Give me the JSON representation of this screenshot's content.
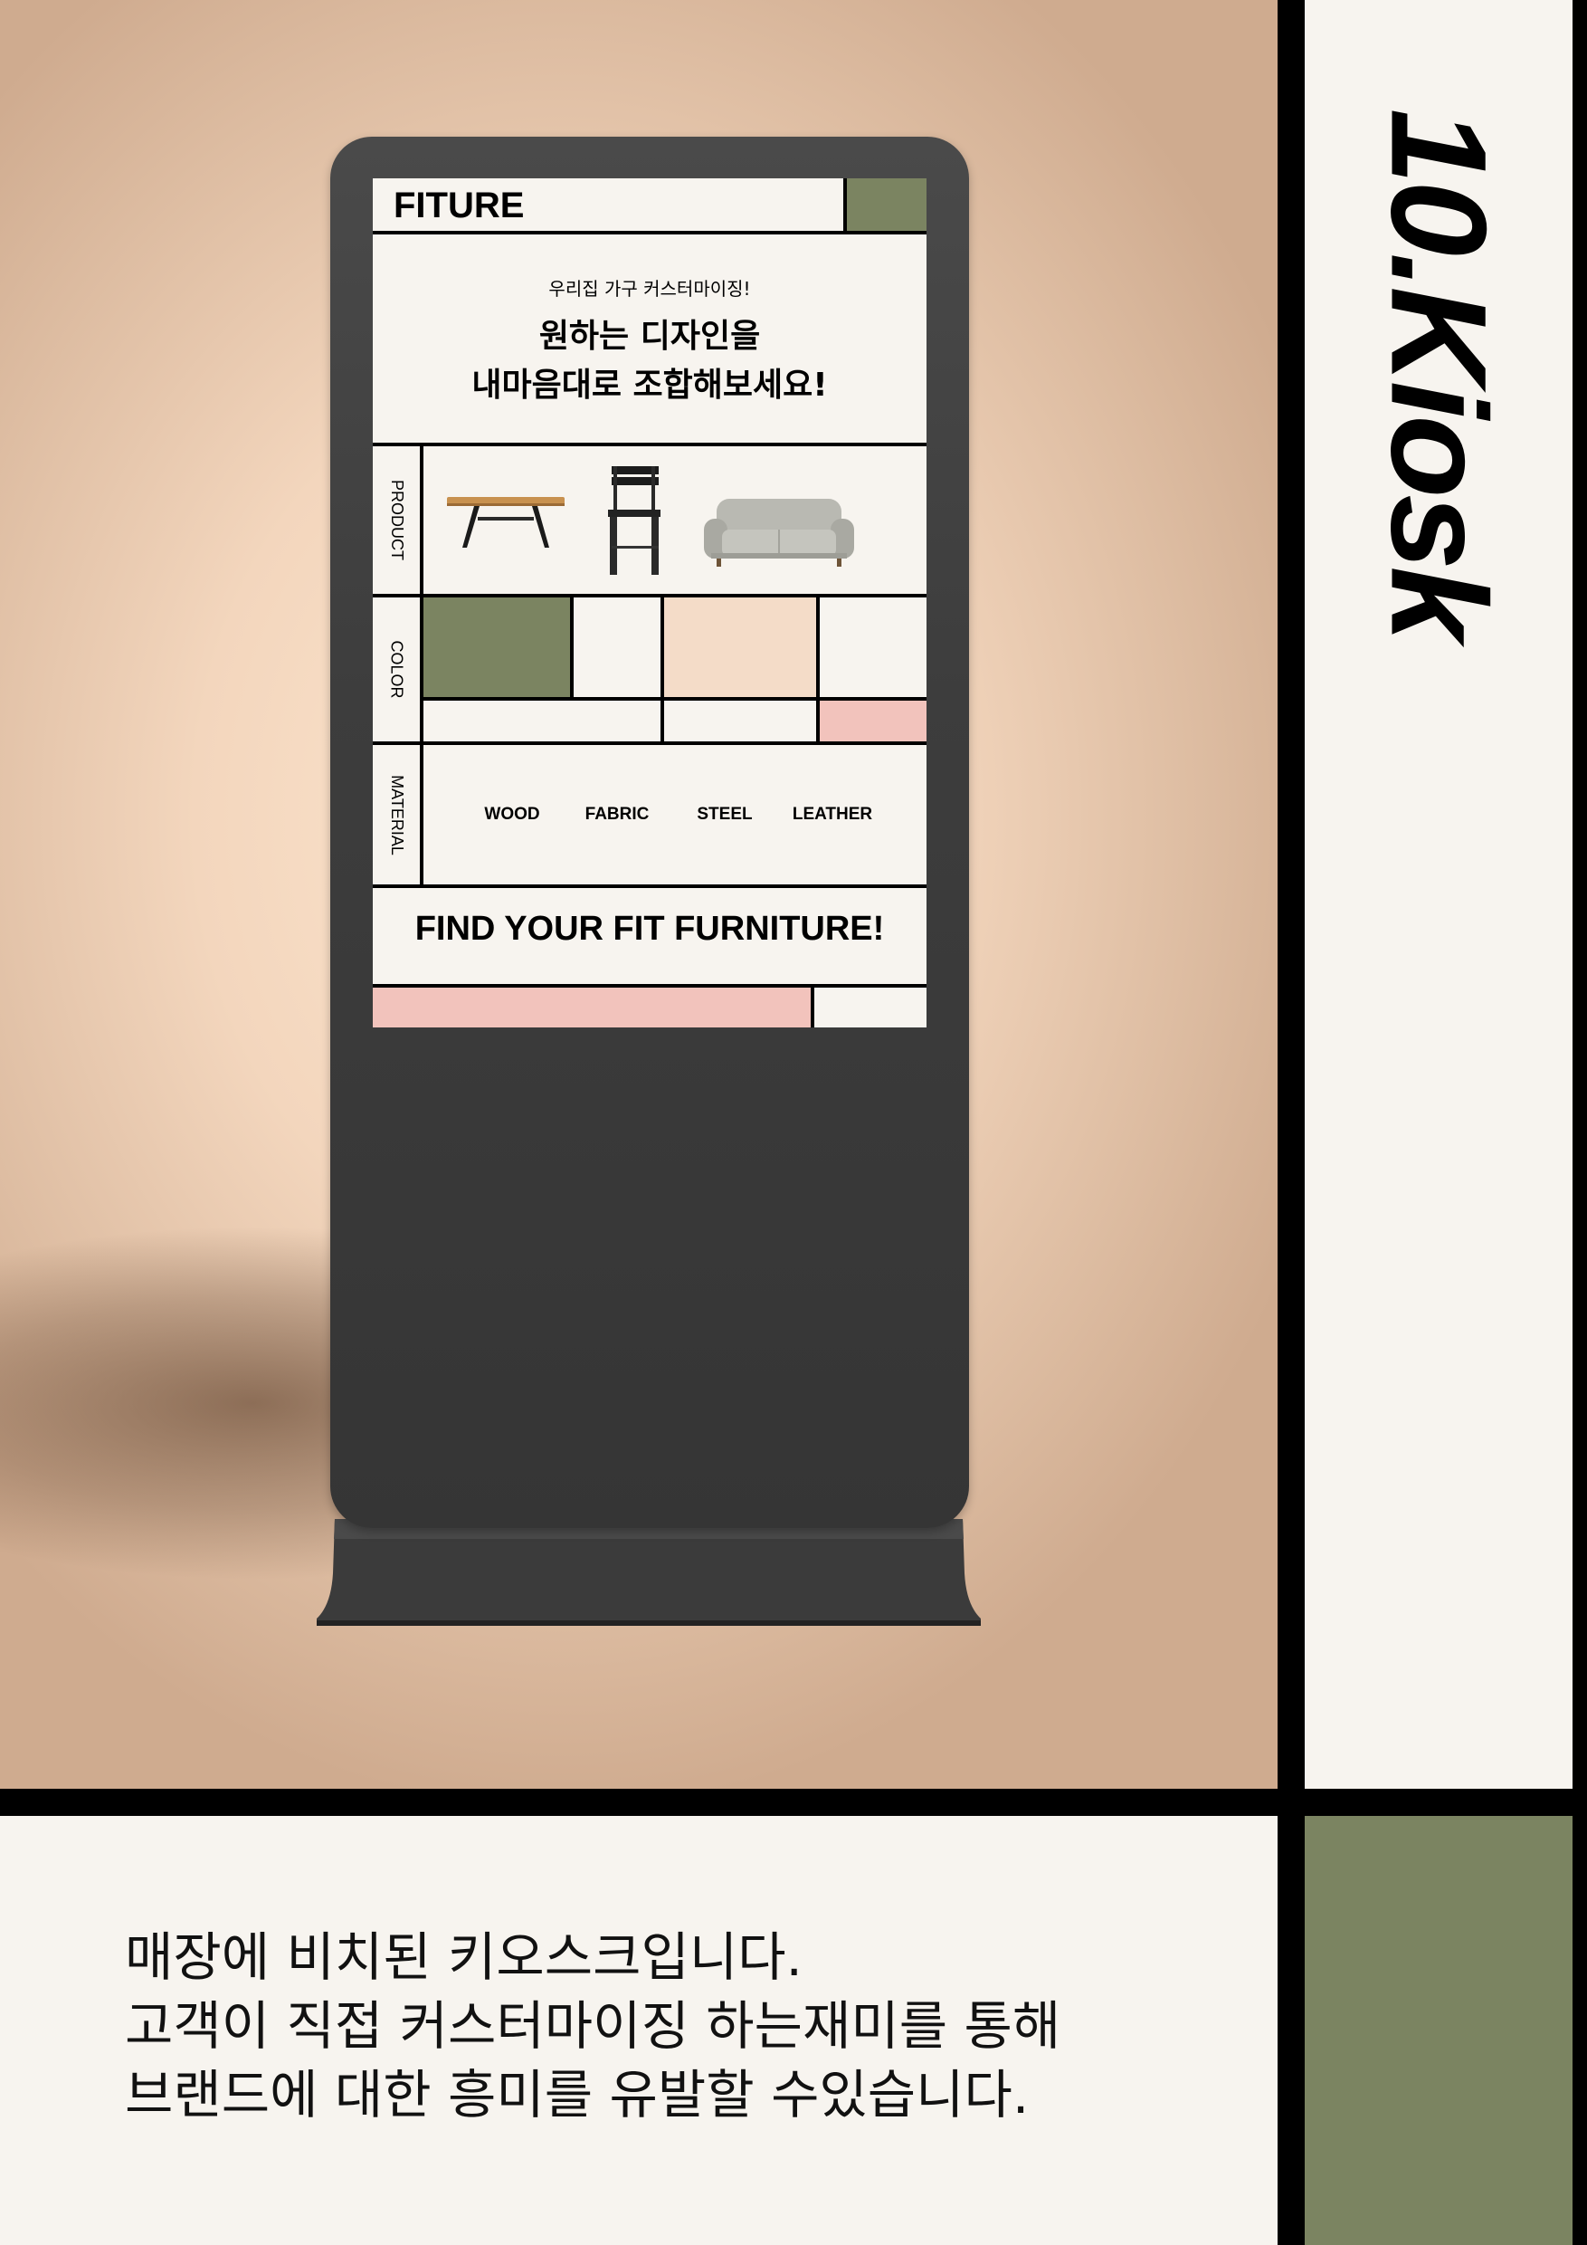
{
  "colors": {
    "olive": "#7b8461",
    "peach": "#f4dcc8",
    "pink": "#f2c3bc",
    "cream": "#f7f4ef",
    "kiosk_body": "#3d3d3d"
  },
  "brand": {
    "title": "10.Kiosk"
  },
  "kiosk": {
    "logo": "FITURE",
    "tagline": "우리집 가구 커스터마이징!",
    "headline_line1": "원하는 디자인을",
    "headline_line2": "내마음대로 조합해보세요!",
    "sections": {
      "product": "PRODUCT",
      "color": "COLOR",
      "material": "MATERIAL"
    },
    "products": [
      {
        "icon": "table-icon"
      },
      {
        "icon": "chair-icon"
      },
      {
        "icon": "sofa-icon"
      }
    ],
    "materials": [
      "WOOD",
      "FABRIC",
      "STEEL",
      "LEATHER"
    ],
    "cta": "FIND YOUR FIT FURNITURE!"
  },
  "description": {
    "line1": "매장에 비치된 키오스크입니다.",
    "line2": "고객이 직접 커스터마이징 하는재미를 통해",
    "line3": "브랜드에 대한 흥미를 유발할 수있습니다."
  }
}
